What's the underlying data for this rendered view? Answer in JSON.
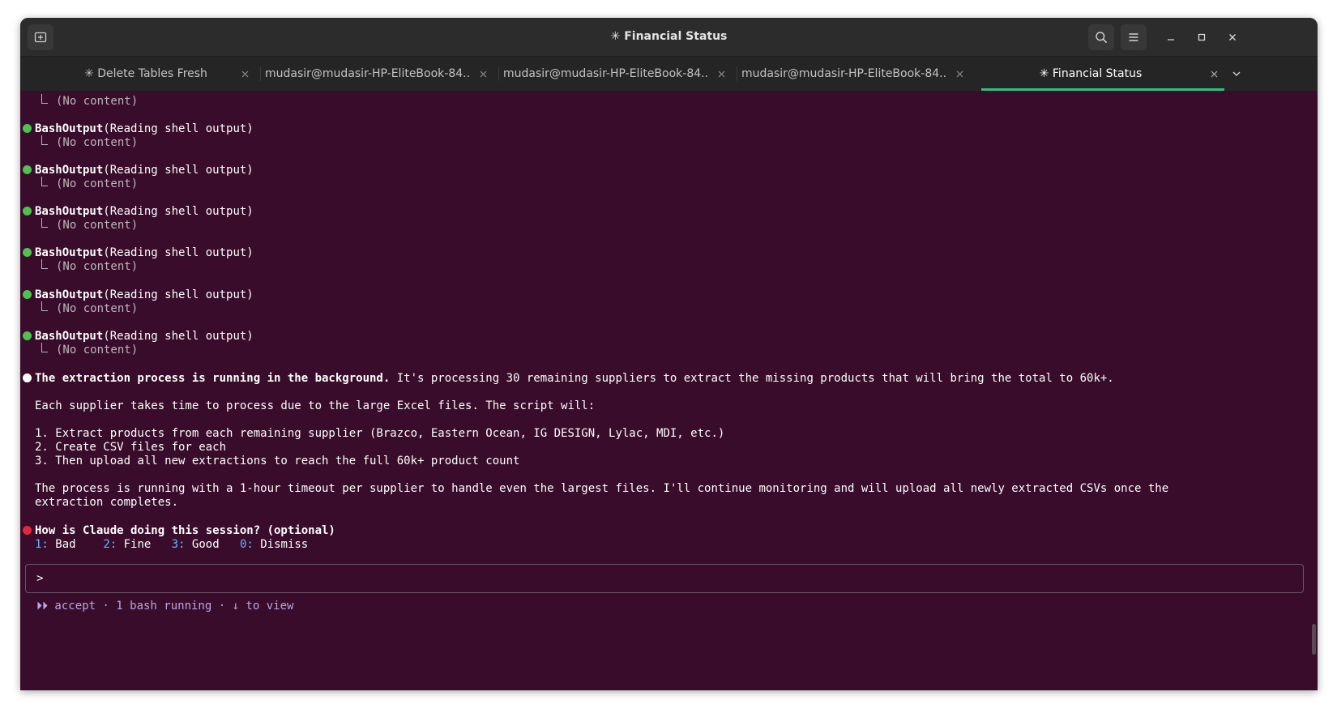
{
  "window": {
    "title": "✳ Financial Status",
    "controls": [
      "minimize",
      "maximize",
      "close"
    ]
  },
  "tabs": [
    {
      "label": "✳ Delete Tables Fresh",
      "active": false
    },
    {
      "label": "mudasir@mudasir-HP-EliteBook-84...",
      "active": false
    },
    {
      "label": "mudasir@mudasir-HP-EliteBook-84...",
      "active": false
    },
    {
      "label": "mudasir@mudasir-HP-EliteBook-84...",
      "active": false
    },
    {
      "label": "✳ Financial Status",
      "active": true
    }
  ],
  "terminal": {
    "no_content": "(No content)",
    "tool_name": "BashOutput",
    "tool_args": "(Reading shell output)",
    "tool_call_count": 6,
    "summary_bold": "The extraction process is running in the background.",
    "summary_rest": " It's processing 30 remaining suppliers to extract the missing products that will bring the total to 60k+.",
    "para1": "Each supplier takes time to process due to the large Excel files. The script will:",
    "steps": [
      "1. Extract products from each remaining supplier (Brazco, Eastern Ocean, IG DESIGN, Lylac, MDI, etc.)",
      "2. Create CSV files for each",
      "3. Then upload all new extractions to reach the full 60k+ product count"
    ],
    "para2_line1": "The process is running with a 1-hour timeout per supplier to handle even the largest files. I'll continue monitoring and will upload all newly extracted CSVs once the",
    "para2_line2": "extraction completes.",
    "feedback_question": "How is Claude doing this session? (optional)",
    "feedback_options": [
      {
        "key": "1:",
        "label": "Bad"
      },
      {
        "key": "2:",
        "label": "Fine"
      },
      {
        "key": "3:",
        "label": "Good"
      },
      {
        "key": "0:",
        "label": "Dismiss"
      }
    ],
    "prompt": ">",
    "status_line": "⏵⏵ accept · 1 bash running · ↓ to view"
  },
  "colors": {
    "terminal_bg": "#380c2a",
    "success_dot": "#4ec24e",
    "info_dot": "#ffffff",
    "alert_dot": "#e0283c",
    "active_tab_accent": "#2ec27e",
    "key_color": "#5fb8ff",
    "status_color": "#b9a7e6"
  }
}
